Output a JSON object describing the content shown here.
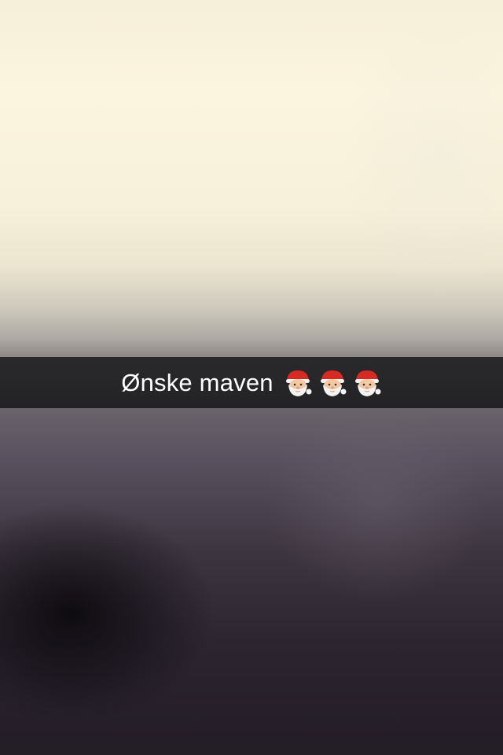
{
  "caption": {
    "text": "Ønske maven",
    "emoji": [
      "santa-emoji",
      "santa-emoji",
      "santa-emoji"
    ]
  },
  "colors": {
    "caption_bar": "#141416",
    "caption_text": "#ffffff",
    "santa_hat": "#d62a22",
    "santa_skin": "#f3c9a4",
    "santa_beard": "#f4f4f2"
  }
}
